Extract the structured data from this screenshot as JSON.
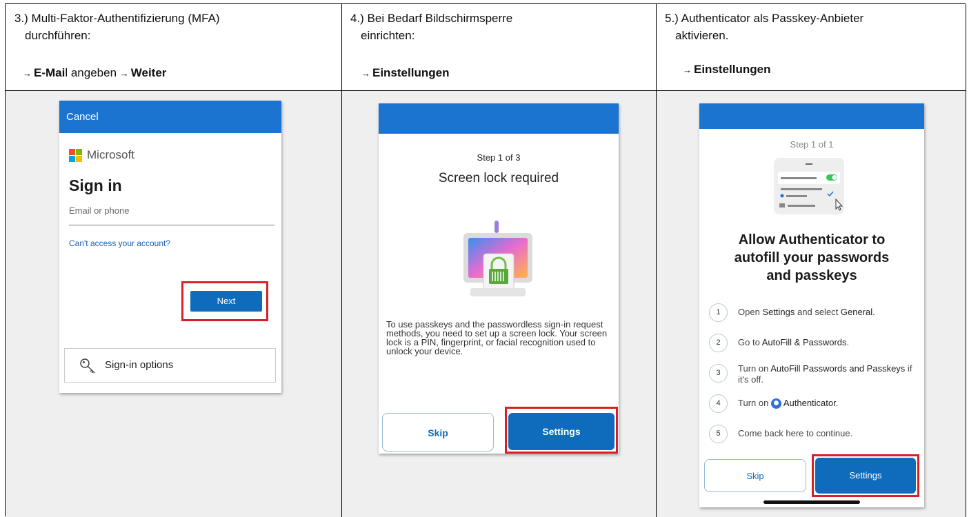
{
  "columns": [
    {
      "heading_line1": "3.) Multi-Faktor-Authentifizierung (MFA)",
      "heading_line2": "durchführen:",
      "sub_arrow1": "→",
      "sub_bold1a": "E-Mai",
      "sub_plain1a": "l angeben ",
      "sub_arrow2": "→",
      "sub_bold1b": "Weiter"
    },
    {
      "heading_line1": "4.) Bei Bedarf Bildschirmsperre",
      "heading_line2": "einrichten:",
      "sub_arrow1": "→",
      "sub_bold1a": "Einstellungen"
    },
    {
      "heading_line1": "5.) Authenticator als Passkey-Anbieter",
      "heading_line2": "aktivieren.",
      "sub_arrow1": "→",
      "sub_bold1a": "Einstellungen"
    }
  ],
  "signin": {
    "cancel": "Cancel",
    "brand": "Microsoft",
    "title": "Sign in",
    "email_placeholder": "Email or phone",
    "cant_access": "Can't access your account?",
    "next": "Next",
    "options": "Sign-in options",
    "logo_colors": [
      "#f25022",
      "#7fba00",
      "#00a4ef",
      "#ffb900"
    ]
  },
  "screenlock": {
    "step": "Step 1 of 3",
    "title": "Screen lock required",
    "body": "To use passkeys and the passwordless sign-in request methods, you need to set up a screen lock. Your screen lock is a PIN, fingerprint, or facial recognition used to unlock your device.",
    "skip": "Skip",
    "settings": "Settings"
  },
  "autofill": {
    "step": "Step 1 of 1",
    "title_line1": "Allow Authenticator to",
    "title_line2": "autofill your passwords",
    "title_line3": "and passkeys",
    "steps": [
      {
        "num": "1",
        "pre": "Open ",
        "b1": "Settings",
        "mid": " and select ",
        "b2": "General",
        "post": "."
      },
      {
        "num": "2",
        "pre": "Go to ",
        "b1": "AutoFill & Passwords",
        "mid": "",
        "b2": "",
        "post": "."
      },
      {
        "num": "3",
        "pre": "Turn on ",
        "b1": "AutoFill Passwords and Passkeys",
        "mid": " if it's off.",
        "b2": "",
        "post": ""
      },
      {
        "num": "4",
        "pre": "Turn on ",
        "b1": "Authenticator",
        "mid": "",
        "b2": "",
        "post": "."
      },
      {
        "num": "5",
        "pre": "Come back here to continue.",
        "b1": "",
        "mid": "",
        "b2": "",
        "post": ""
      }
    ],
    "skip": "Skip",
    "settings": "Settings"
  },
  "colors": {
    "accent": "#1b74d0",
    "button": "#0f6cbd",
    "highlight": "#d81f28"
  }
}
